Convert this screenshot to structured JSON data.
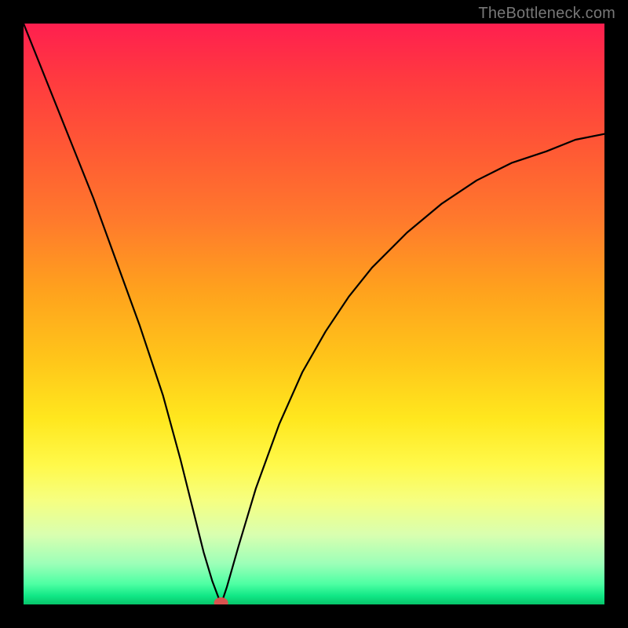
{
  "watermark": "TheBottleneck.com",
  "marker": {
    "color": "#d9534f",
    "radius": 7
  },
  "curve_stroke": "#000000",
  "curve_width": 2.2,
  "chart_data": {
    "type": "line",
    "title": "",
    "xlabel": "",
    "ylabel": "",
    "xlim": [
      0,
      100
    ],
    "ylim": [
      0,
      100
    ],
    "grid": false,
    "annotations": [
      "TheBottleneck.com"
    ],
    "marker_point": {
      "x": 34,
      "y": 0
    },
    "series": [
      {
        "name": "bottleneck-curve",
        "x": [
          0,
          4,
          8,
          12,
          16,
          20,
          24,
          27,
          29,
          31,
          32.5,
          34,
          35,
          37,
          40,
          44,
          48,
          52,
          56,
          60,
          66,
          72,
          78,
          84,
          90,
          95,
          100
        ],
        "values": [
          100,
          90,
          80,
          70,
          59,
          48,
          36,
          25,
          17,
          9,
          4,
          0,
          3,
          10,
          20,
          31,
          40,
          47,
          53,
          58,
          64,
          69,
          73,
          76,
          78,
          80,
          81
        ]
      }
    ]
  }
}
